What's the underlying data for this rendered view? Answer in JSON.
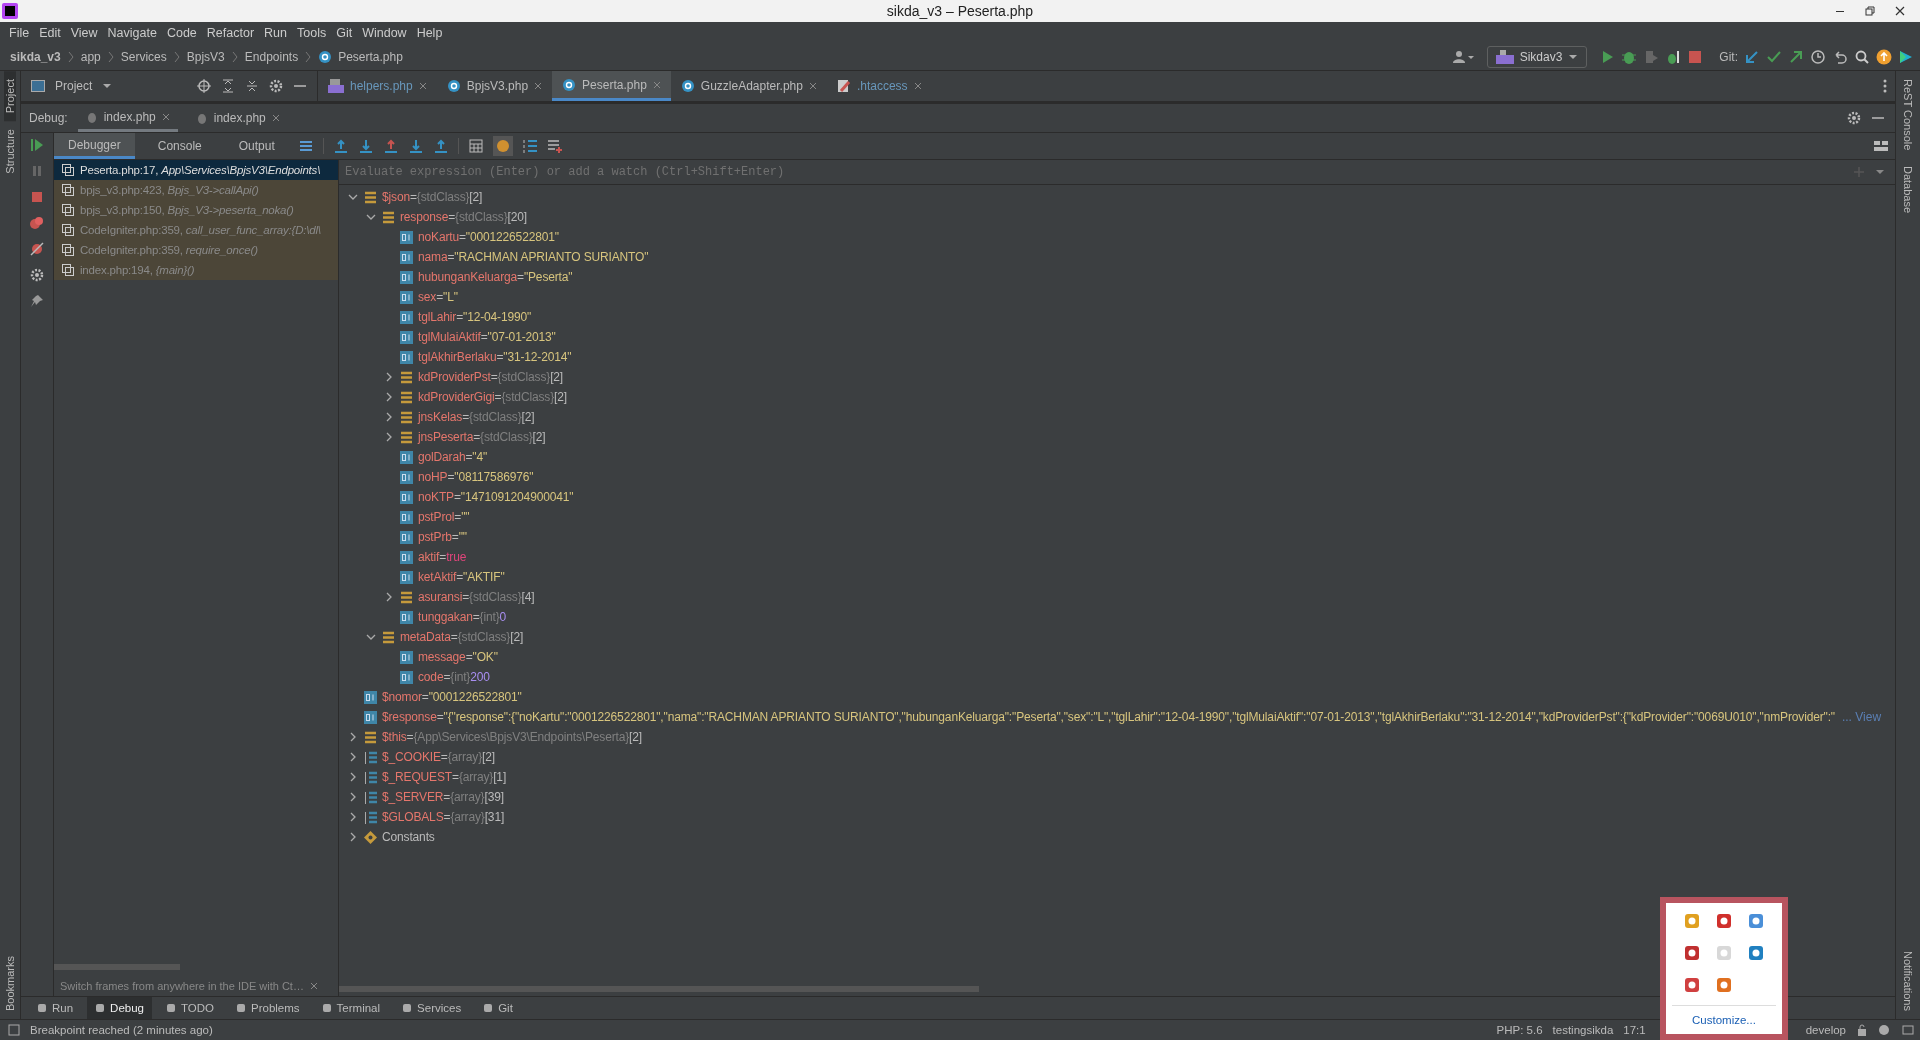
{
  "window": {
    "title": "sikda_v3 – Peserta.php"
  },
  "menu": [
    "File",
    "Edit",
    "View",
    "Navigate",
    "Code",
    "Refactor",
    "Run",
    "Tools",
    "Git",
    "Window",
    "Help"
  ],
  "breadcrumbs": [
    "sikda_v3",
    "app",
    "Services",
    "BpjsV3",
    "Endpoints",
    "Peserta.php"
  ],
  "toolbar": {
    "run_config": "Sikdav3",
    "git_label": "Git:"
  },
  "project_tool": {
    "label": "Project"
  },
  "editor_tabs": [
    {
      "label": "helpers.php",
      "kind": "php",
      "selected": false
    },
    {
      "label": "BpjsV3.php",
      "kind": "class",
      "selected": false
    },
    {
      "label": "Peserta.php",
      "kind": "class",
      "selected": true
    },
    {
      "label": "GuzzleAdapter.php",
      "kind": "class",
      "selected": false
    },
    {
      "label": ".htaccess",
      "kind": "config",
      "selected": false
    }
  ],
  "debug": {
    "label": "Debug:",
    "sessions": [
      {
        "label": "index.php",
        "selected": true
      },
      {
        "label": "index.php",
        "selected": false
      }
    ],
    "tabs": [
      {
        "label": "Debugger",
        "selected": true
      },
      {
        "label": "Console",
        "selected": false
      },
      {
        "label": "Output",
        "selected": false
      }
    ],
    "frames": [
      {
        "location": "Peserta.php:17, ",
        "method": "App\\Services\\BpjsV3\\Endpoints\\",
        "selected": true
      },
      {
        "location": "bpjs_v3.php:423, ",
        "method": "Bpjs_V3->callApi()",
        "selected": false
      },
      {
        "location": "bpjs_v3.php:150, ",
        "method": "Bpjs_V3->peserta_noka()",
        "selected": false
      },
      {
        "location": "CodeIgniter.php:359, ",
        "method": "call_user_func_array:{D:\\dl\\",
        "selected": false
      },
      {
        "location": "CodeIgniter.php:359, ",
        "method": "require_once()",
        "selected": false
      },
      {
        "location": "index.php:194, ",
        "method": "{main}()",
        "selected": false
      }
    ],
    "hint": "Switch frames from anywhere in the IDE with Ct…",
    "watch_placeholder": "Evaluate expression (Enter) or add a watch (Ctrl+Shift+Enter)",
    "variables": [
      {
        "name": "$json",
        "kind": "object",
        "sep": "=",
        "type": "{stdClass}",
        "count": "[2]",
        "expanded": true,
        "children": [
          {
            "name": "response",
            "kind": "object",
            "sep": "=",
            "type": "{stdClass}",
            "count": "[20]",
            "expanded": true,
            "children": [
              {
                "name": "noKartu",
                "kind": "string",
                "sep": "=",
                "value": "\"0001226522801\""
              },
              {
                "name": "nama",
                "kind": "string",
                "sep": "=",
                "value": "\"RACHMAN APRIANTO SURIANTO\""
              },
              {
                "name": "hubunganKeluarga",
                "kind": "string",
                "sep": "=",
                "value": "\"Peserta\""
              },
              {
                "name": "sex",
                "kind": "string",
                "sep": "=",
                "value": "\"L\""
              },
              {
                "name": "tglLahir",
                "kind": "string",
                "sep": "=",
                "value": "\"12-04-1990\""
              },
              {
                "name": "tglMulaiAktif",
                "kind": "string",
                "sep": "=",
                "value": "\"07-01-2013\""
              },
              {
                "name": "tglAkhirBerlaku",
                "kind": "string",
                "sep": "=",
                "value": "\"31-12-2014\""
              },
              {
                "name": "kdProviderPst",
                "kind": "object",
                "sep": "=",
                "type": "{stdClass}",
                "count": "[2]",
                "expanded": false
              },
              {
                "name": "kdProviderGigi",
                "kind": "object",
                "sep": "=",
                "type": "{stdClass}",
                "count": "[2]",
                "expanded": false
              },
              {
                "name": "jnsKelas",
                "kind": "object",
                "sep": "=",
                "type": "{stdClass}",
                "count": "[2]",
                "expanded": false
              },
              {
                "name": "jnsPeserta",
                "kind": "object",
                "sep": "=",
                "type": "{stdClass}",
                "count": "[2]",
                "expanded": false
              },
              {
                "name": "golDarah",
                "kind": "string",
                "sep": "=",
                "value": "\"4\""
              },
              {
                "name": "noHP",
                "kind": "string",
                "sep": "=",
                "value": "\"08117586976\""
              },
              {
                "name": "noKTP",
                "kind": "string",
                "sep": "=",
                "value": "\"1471091204900041\""
              },
              {
                "name": "pstProl",
                "kind": "string",
                "sep": "=",
                "value": "\"\""
              },
              {
                "name": "pstPrb",
                "kind": "string",
                "sep": "=",
                "value": "\"\""
              },
              {
                "name": "aktif",
                "kind": "bool",
                "sep": "=",
                "value": "true"
              },
              {
                "name": "ketAktif",
                "kind": "string",
                "sep": "=",
                "value": "\"AKTIF\""
              },
              {
                "name": "asuransi",
                "kind": "object",
                "sep": "=",
                "type": "{stdClass}",
                "count": "[4]",
                "expanded": false
              },
              {
                "name": "tunggakan",
                "kind": "number",
                "sep": "=",
                "type": "{int}",
                "value": "0"
              }
            ]
          },
          {
            "name": "metaData",
            "kind": "object",
            "sep": "=",
            "type": "{stdClass}",
            "count": "[2]",
            "expanded": true,
            "children": [
              {
                "name": "message",
                "kind": "string",
                "sep": "=",
                "value": "\"OK\""
              },
              {
                "name": "code",
                "kind": "number",
                "sep": "=",
                "type": "{int}",
                "value": "200"
              }
            ]
          }
        ]
      },
      {
        "name": "$nomor",
        "kind": "string",
        "sep": "=",
        "value": "\"0001226522801\""
      },
      {
        "name": "$response",
        "kind": "string",
        "sep": "=",
        "value": "\"{\"response\":{\"noKartu\":\"0001226522801\",\"nama\":\"RACHMAN APRIANTO SURIANTO\",\"hubunganKeluarga\":\"Peserta\",\"sex\":\"L\",\"tglLahir\":\"12-04-1990\",\"tglMulaiAktif\":\"07-01-2013\",\"tglAkhirBerlaku\":\"31-12-2014\",\"kdProviderPst\":{\"kdProvider\":\"0069U010\",\"nmProvider\":\"",
        "link": "... View"
      },
      {
        "name": "$this",
        "kind": "object",
        "sep": "=",
        "type": "{App\\Services\\BpjsV3\\Endpoints\\Peserta}",
        "count": "[2]",
        "expanded": false
      },
      {
        "name": "$_COOKIE",
        "kind": "array",
        "sep": "=",
        "type": "{array}",
        "count": "[2]",
        "expanded": false
      },
      {
        "name": "$_REQUEST",
        "kind": "array",
        "sep": "=",
        "type": "{array}",
        "count": "[1]",
        "expanded": false
      },
      {
        "name": "$_SERVER",
        "kind": "array",
        "sep": "=",
        "type": "{array}",
        "count": "[39]",
        "expanded": false
      },
      {
        "name": "$GLOBALS",
        "kind": "array",
        "sep": "=",
        "type": "{array}",
        "count": "[31]",
        "expanded": false
      },
      {
        "name": "Constants",
        "kind": "constants",
        "expanded": false
      }
    ]
  },
  "side_tools": {
    "left": [
      {
        "label": "Project",
        "selected": true
      },
      {
        "label": "Structure",
        "selected": false
      }
    ],
    "left_bottom": [
      {
        "label": "Bookmarks",
        "selected": false
      }
    ],
    "right": [
      {
        "label": "ReST Console",
        "selected": false
      },
      {
        "label": "Database",
        "selected": false
      }
    ],
    "right_bottom": [
      {
        "label": "Notifications",
        "selected": false
      }
    ]
  },
  "tool_tabs": [
    {
      "label": "Run",
      "selected": false
    },
    {
      "label": "Debug",
      "selected": true
    },
    {
      "label": "TODO",
      "selected": false
    },
    {
      "label": "Problems",
      "selected": false
    },
    {
      "label": "Terminal",
      "selected": false
    },
    {
      "label": "Services",
      "selected": false
    },
    {
      "label": "Git",
      "selected": false
    }
  ],
  "status_bar": {
    "message": "Breakpoint reached (2 minutes ago)",
    "items": [
      "PHP: 5.6",
      "testingsikda",
      "17:1"
    ],
    "branch": "develop"
  },
  "tray": {
    "link": "Customize..."
  }
}
